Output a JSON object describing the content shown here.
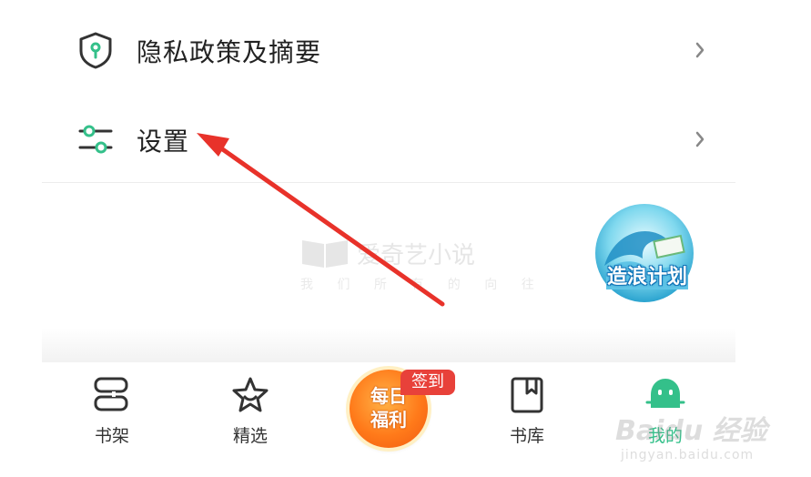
{
  "menu": {
    "items": [
      {
        "label": "隐私政策及摘要",
        "icon": "shield-icon"
      },
      {
        "label": "设置",
        "icon": "sliders-icon"
      }
    ]
  },
  "watermark": {
    "title": "爱奇艺小说",
    "slogan": "我 们 所 有 的 向 往"
  },
  "promo": {
    "label": "造浪计划"
  },
  "tabbar": {
    "tabs": [
      {
        "label": "书架",
        "icon": "bookshelf-icon"
      },
      {
        "label": "精选",
        "icon": "star-icon"
      },
      {
        "label": "书库",
        "icon": "library-icon"
      },
      {
        "label": "我的",
        "icon": "profile-icon"
      }
    ],
    "center": {
      "line1": "每日",
      "line2": "福利",
      "badge": "签到"
    }
  },
  "baidu_watermark": {
    "text": "Baidu 经验",
    "url": "jingyan.baidu.com"
  },
  "colors": {
    "accent_green": "#34c08a",
    "annotation_red": "#e8322a",
    "badge_red": "#e8413a",
    "center_orange": "#ff7a1a"
  }
}
